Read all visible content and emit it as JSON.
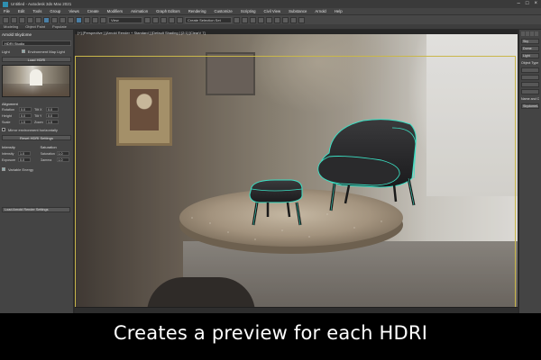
{
  "window": {
    "title": "Untitled - Autodesk 3ds Max 2021",
    "controls": [
      "–",
      "□",
      "×"
    ]
  },
  "menu": [
    "File",
    "Edit",
    "Tools",
    "Group",
    "Views",
    "Create",
    "Modifiers",
    "Animation",
    "Graph Editors",
    "Rendering",
    "Customize",
    "Scripting",
    "Civil View",
    "Substance",
    "Arnold",
    "Help"
  ],
  "toolbar": {
    "selection_set": "Create Selection Set",
    "view_combo": "View"
  },
  "ribbon": [
    "Modeling",
    "Object Paint",
    "Populate"
  ],
  "left_panel": {
    "header": "Arnold Skydome",
    "search_value": "HDRI Studio",
    "light_label": "Light",
    "env_map_label": "Environment Map Light",
    "env_map_checked": true,
    "load_button": "Load HDRI",
    "alignment_title": "Alignment",
    "fields": [
      {
        "label": "Rotation",
        "value": "0.0",
        "label2": "Tilt X",
        "value2": "0.0"
      },
      {
        "label": "Height",
        "value": "0.0",
        "label2": "Tilt Y",
        "value2": "0.0"
      },
      {
        "label": "Scale",
        "value": "1.0",
        "label2": "Zoom",
        "value2": "1.0"
      }
    ],
    "mirror_label": "Mirror environment horizontally",
    "mirror_checked": false,
    "reset_button": "Reset HDRI Settings",
    "intensity_title": "Intensity",
    "intensity_rows": [
      {
        "label": "Intensity",
        "value": "1.0"
      },
      {
        "label": "Exposure",
        "value": "0.0"
      }
    ],
    "saturation_title": "Saturation",
    "saturation_rows": [
      {
        "label": "Saturation",
        "value": "1.0"
      },
      {
        "label": "Gamma",
        "value": "1.0"
      }
    ],
    "variable_label": "Variable Energy",
    "footer_button": "Load Arnold Render Settings"
  },
  "viewport": {
    "label": "[+] [Perspective ] [Arnold Render + Standard ] [Default Shading ] [2:1] [ClearV 7]"
  },
  "right_panel": {
    "items": [
      "Sky",
      "Dome",
      "Light",
      "Object Type",
      "Name and Color",
      "SkydomeLight001"
    ],
    "labels": [
      "Object Type",
      "Name and Color",
      "SkydomeLight001"
    ]
  },
  "caption": "Creates a preview for each HDRI",
  "colors": {
    "selection_outline": "#3be0c4",
    "viewport_bounds": "#c9b74a",
    "caption_bg": "#000000"
  }
}
